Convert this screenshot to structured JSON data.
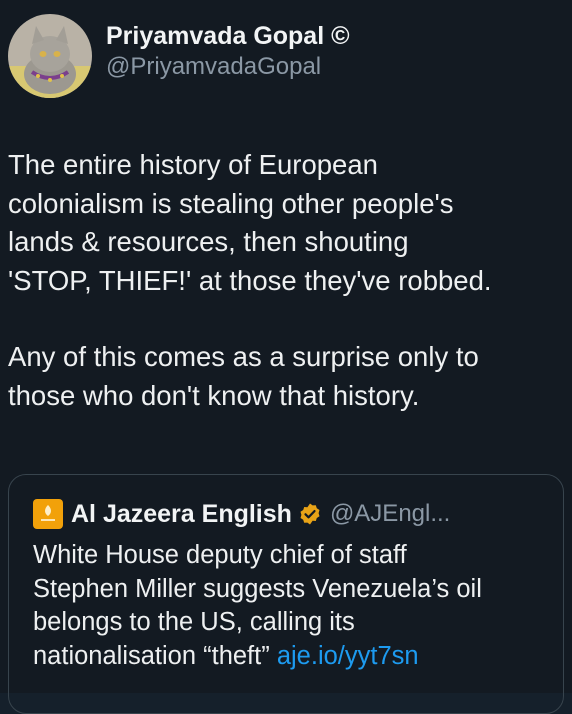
{
  "tweet": {
    "author": {
      "display_name": "Priyamvada Gopal ©",
      "handle": "@PriyamvadaGopal"
    },
    "text_paragraph_1": "The entire history of European\ncolonialism is stealing other people's\nlands & resources, then shouting\n'STOP, THIEF!' at those they've robbed.",
    "text_paragraph_2": "Any of this comes as a surprise only to\nthose who don't know that history."
  },
  "quote": {
    "author": {
      "display_name": "Al Jazeera English",
      "handle": "@AJEngl..."
    },
    "text": "White House deputy chief of staff\nStephen Miller suggests Venezuela’s oil\nbelongs to the US, calling its\nnationalisation “theft”",
    "link": "aje.io/yyt7sn"
  },
  "colors": {
    "background": "#131a22",
    "text_primary": "#e7e9ea",
    "text_secondary": "#8b98a5",
    "link": "#1d9bf0",
    "verified_badge": "#e8a317",
    "al_jazeera_brand": "#f2a10a"
  },
  "icons": {
    "avatar": "cat-avatar-icon",
    "quote_logo": "al-jazeera-logo-icon",
    "verified": "verified-badge-icon"
  }
}
